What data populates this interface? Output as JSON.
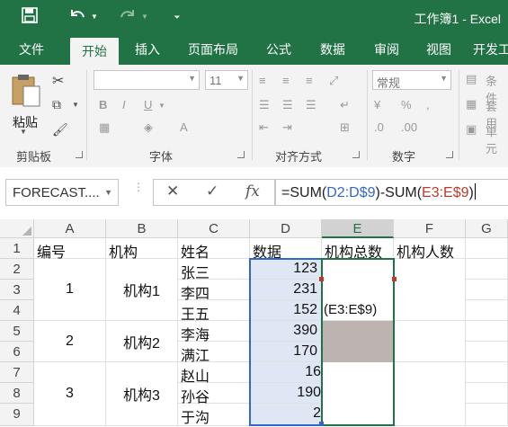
{
  "title_bar": {
    "title": "工作簿1 - Excel",
    "save_icon": "save-icon",
    "undo_icon": "undo-icon",
    "redo_icon": "redo-icon",
    "customize_icon": "customize-qat-icon"
  },
  "ribbon_tabs": [
    "文件",
    "开始",
    "插入",
    "页面布局",
    "公式",
    "数据",
    "审阅",
    "视图",
    "开发工"
  ],
  "active_tab": "开始",
  "ribbon": {
    "clipboard": {
      "paste_label": "粘贴",
      "group_label": "剪贴板"
    },
    "font": {
      "size_value": "11",
      "bold": "B",
      "italic": "I",
      "underline": "U",
      "group_label": "字体"
    },
    "alignment": {
      "group_label": "对齐方式"
    },
    "number": {
      "format_value": "常规",
      "group_label": "数字"
    },
    "styles": {
      "conditional_label": "条件",
      "table_label": "套用",
      "cell_label": "单元"
    }
  },
  "formula_bar": {
    "name_box": "FORECAST....",
    "cancel_icon": "cancel-icon",
    "enter_icon": "check-icon",
    "fx_label": "fx",
    "formula_parts": [
      "=SUM(",
      "D2:D$9",
      ")-SUM(",
      "E3:E$9",
      ")"
    ]
  },
  "columns": [
    "A",
    "B",
    "C",
    "D",
    "E",
    "F",
    "G"
  ],
  "active_column": "E",
  "rows": [
    "1",
    "2",
    "3",
    "4",
    "5",
    "6",
    "7",
    "8",
    "9"
  ],
  "header_row": [
    "编号",
    "机构",
    "姓名",
    "数据",
    "机构总数",
    "机构人数"
  ],
  "groups": [
    {
      "id": "1",
      "org": "机构1"
    },
    {
      "id": "2",
      "org": "机构2"
    },
    {
      "id": "3",
      "org": "机构3"
    }
  ],
  "names": [
    "张三",
    "李四",
    "王五",
    "李海",
    "满江",
    "赵山",
    "孙谷",
    "于沟"
  ],
  "data_values": [
    "123",
    "231",
    "152",
    "390",
    "170",
    "16",
    "190",
    "2"
  ],
  "editing_cell_text": "(E3:E$9)",
  "colors": {
    "excel_green": "#217346",
    "reference_blue": "#3366cc",
    "reference_red": "#c0392b",
    "range_fill": "#dfe7f5"
  }
}
